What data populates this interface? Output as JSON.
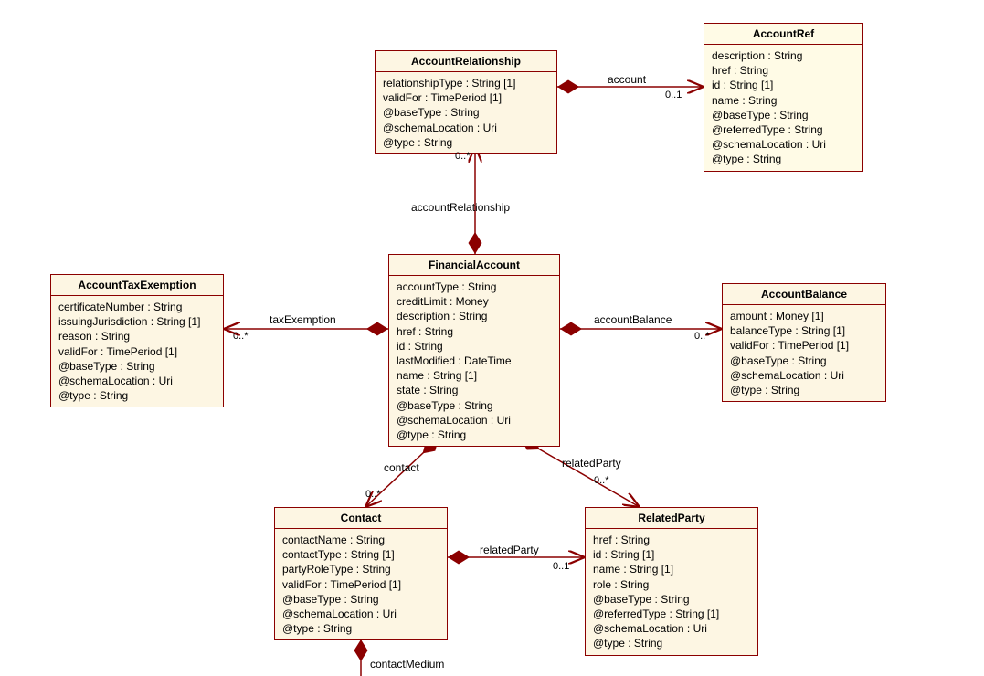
{
  "classes": {
    "AccountRelationship": {
      "name": "AccountRelationship",
      "attrs": [
        "relationshipType : String [1]",
        "validFor : TimePeriod [1]",
        "@baseType : String",
        "@schemaLocation : Uri",
        "@type : String"
      ]
    },
    "AccountRef": {
      "name": "AccountRef",
      "attrs": [
        "description : String",
        "href : String",
        "id : String [1]",
        "name : String",
        "@baseType : String",
        "@referredType : String",
        "@schemaLocation : Uri",
        "@type : String"
      ]
    },
    "FinancialAccount": {
      "name": "FinancialAccount",
      "attrs": [
        "accountType : String",
        "creditLimit : Money",
        "description : String",
        "href : String",
        "id : String",
        "lastModified : DateTime",
        "name : String [1]",
        "state : String",
        "@baseType : String",
        "@schemaLocation : Uri",
        "@type : String"
      ]
    },
    "AccountTaxExemption": {
      "name": "AccountTaxExemption",
      "attrs": [
        "certificateNumber : String",
        "issuingJurisdiction : String [1]",
        "reason : String",
        "validFor : TimePeriod [1]",
        "@baseType : String",
        "@schemaLocation : Uri",
        "@type : String"
      ]
    },
    "AccountBalance": {
      "name": "AccountBalance",
      "attrs": [
        "amount : Money [1]",
        "balanceType : String [1]",
        "validFor : TimePeriod [1]",
        "@baseType : String",
        "@schemaLocation : Uri",
        "@type : String"
      ]
    },
    "Contact": {
      "name": "Contact",
      "attrs": [
        "contactName : String",
        "contactType : String [1]",
        "partyRoleType : String",
        "validFor : TimePeriod [1]",
        "@baseType : String",
        "@schemaLocation : Uri",
        "@type : String"
      ]
    },
    "RelatedParty": {
      "name": "RelatedParty",
      "attrs": [
        "href : String",
        "id : String [1]",
        "name : String [1]",
        "role : String",
        "@baseType : String",
        "@referredType : String [1]",
        "@schemaLocation : Uri",
        "@type : String"
      ]
    }
  },
  "assocs": {
    "AccountRelationship_AccountRef": {
      "label": "account",
      "mult": "0..1"
    },
    "FinancialAccount_AccountRelationship": {
      "label": "accountRelationship",
      "mult": "0..*"
    },
    "FinancialAccount_AccountTaxExemption": {
      "label": "taxExemption",
      "mult": "0..*"
    },
    "FinancialAccount_AccountBalance": {
      "label": "accountBalance",
      "mult": "0..*"
    },
    "FinancialAccount_Contact": {
      "label": "contact",
      "mult": "0..*"
    },
    "FinancialAccount_RelatedParty": {
      "label": "relatedParty",
      "mult": "0..*"
    },
    "Contact_RelatedParty": {
      "label": "relatedParty",
      "mult": "0..1"
    },
    "Contact_contactMedium": {
      "label": "contactMedium"
    }
  }
}
